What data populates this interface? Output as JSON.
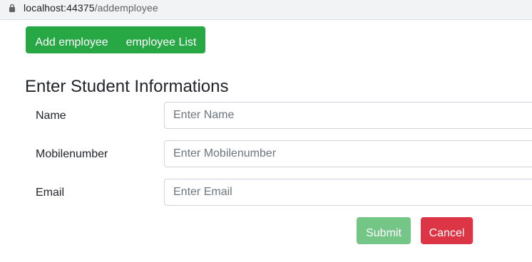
{
  "browser": {
    "url_host": "localhost:44375",
    "url_path": "/addemployee",
    "lock_icon": "lock-icon"
  },
  "nav": {
    "add_employee_label": "Add employee",
    "employee_list_label": "employee List"
  },
  "form": {
    "heading": "Enter Student Informations",
    "fields": [
      {
        "label": "Name",
        "placeholder": "Enter Name",
        "value": ""
      },
      {
        "label": "Mobilenumber",
        "placeholder": "Enter Mobilenumber",
        "value": ""
      },
      {
        "label": "Email",
        "placeholder": "Enter Email",
        "value": ""
      }
    ],
    "submit_label": "Submit",
    "cancel_label": "Cancel"
  },
  "colors": {
    "success": "#28a745",
    "submit_disabled": "#74c687",
    "danger": "#dc3545",
    "input_border": "#ced4da"
  }
}
